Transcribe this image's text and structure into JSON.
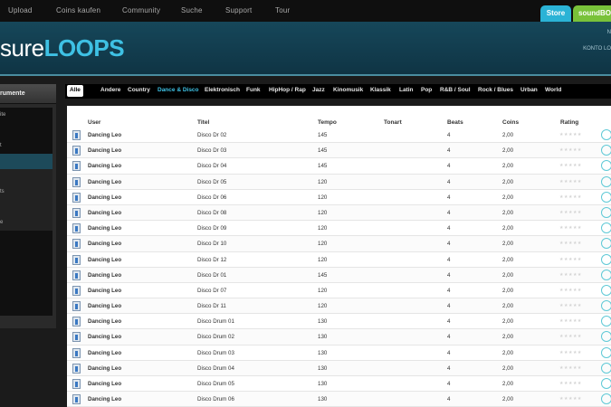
{
  "topnav": {
    "items": [
      "Upload",
      "Coins kaufen",
      "Community",
      "Suche",
      "Support",
      "Tour"
    ],
    "store_tab": "Store",
    "soundbox_tab": "soundBOX"
  },
  "header": {
    "logo_left": "sure",
    "logo_right": "LOOPS",
    "right_line1": "N",
    "right_line2": "KONTO LO"
  },
  "sidebar": {
    "title": "rumente",
    "items": [
      "ite",
      "",
      "t",
      "",
      "",
      "ts",
      "",
      "e",
      "",
      ""
    ]
  },
  "genres": [
    "Alle",
    "Andere",
    "Country",
    "Dance & Disco",
    "Elektronisch",
    "Funk",
    "HipHop / Rap",
    "Jazz",
    "Kinomusik",
    "Klassik",
    "Latin",
    "Pop",
    "R&B / Soul",
    "Rock / Blues",
    "Urban",
    "World"
  ],
  "active_genre": "Dance & Disco",
  "table": {
    "headers": [
      "User",
      "Titel",
      "Tempo",
      "Tonart",
      "Beats",
      "Coins",
      "Rating"
    ],
    "rows": [
      {
        "user": "Dancing Leo",
        "title": "Disco Dr 02",
        "tempo": "145",
        "beats": "4",
        "coins": "2,00"
      },
      {
        "user": "Dancing Leo",
        "title": "Disco Dr 03",
        "tempo": "145",
        "beats": "4",
        "coins": "2,00"
      },
      {
        "user": "Dancing Leo",
        "title": "Disco Dr 04",
        "tempo": "145",
        "beats": "4",
        "coins": "2,00"
      },
      {
        "user": "Dancing Leo",
        "title": "Disco Dr 05",
        "tempo": "120",
        "beats": "4",
        "coins": "2,00"
      },
      {
        "user": "Dancing Leo",
        "title": "Disco Dr 06",
        "tempo": "120",
        "beats": "4",
        "coins": "2,00"
      },
      {
        "user": "Dancing Leo",
        "title": "Disco Dr 08",
        "tempo": "120",
        "beats": "4",
        "coins": "2,00"
      },
      {
        "user": "Dancing Leo",
        "title": "Disco Dr 09",
        "tempo": "120",
        "beats": "4",
        "coins": "2,00"
      },
      {
        "user": "Dancing Leo",
        "title": "Disco Dr 10",
        "tempo": "120",
        "beats": "4",
        "coins": "2,00"
      },
      {
        "user": "Dancing Leo",
        "title": "Disco Dr 12",
        "tempo": "120",
        "beats": "4",
        "coins": "2,00"
      },
      {
        "user": "Dancing Leo",
        "title": "Disco Dr 01",
        "tempo": "145",
        "beats": "4",
        "coins": "2,00"
      },
      {
        "user": "Dancing Leo",
        "title": "Disco Dr 07",
        "tempo": "120",
        "beats": "4",
        "coins": "2,00"
      },
      {
        "user": "Dancing Leo",
        "title": "Disco Dr 11",
        "tempo": "120",
        "beats": "4",
        "coins": "2,00"
      },
      {
        "user": "Dancing Leo",
        "title": "Disco Drum 01",
        "tempo": "130",
        "beats": "4",
        "coins": "2,00"
      },
      {
        "user": "Dancing Leo",
        "title": "Disco Drum 02",
        "tempo": "130",
        "beats": "4",
        "coins": "2,00"
      },
      {
        "user": "Dancing Leo",
        "title": "Disco Drum 03",
        "tempo": "130",
        "beats": "4",
        "coins": "2,00"
      },
      {
        "user": "Dancing Leo",
        "title": "Disco Drum 04",
        "tempo": "130",
        "beats": "4",
        "coins": "2,00"
      },
      {
        "user": "Dancing Leo",
        "title": "Disco Drum 05",
        "tempo": "130",
        "beats": "4",
        "coins": "2,00"
      },
      {
        "user": "Dancing Leo",
        "title": "Disco Drum 06",
        "tempo": "130",
        "beats": "4",
        "coins": "2,00"
      }
    ]
  },
  "colors": {
    "accent": "#3ec1e4",
    "store": "#2bb3d6",
    "soundbox": "#79c23a",
    "header_bg": "#16475a"
  }
}
